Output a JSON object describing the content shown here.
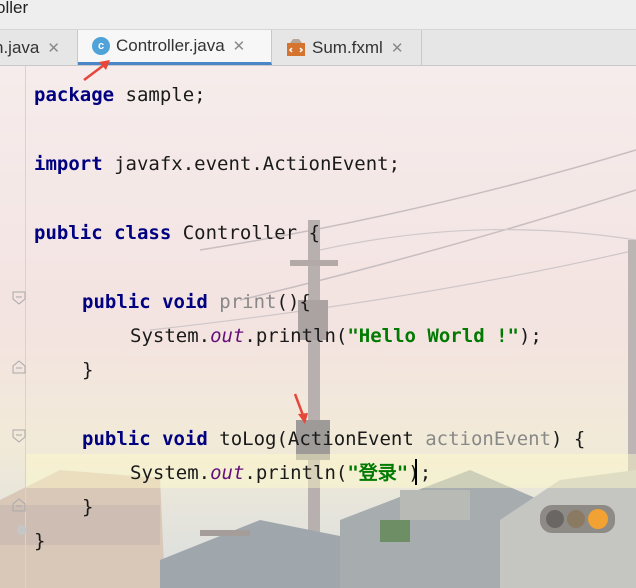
{
  "window": {
    "title": "oller"
  },
  "tabs": [
    {
      "label": "n.java",
      "close": "✕",
      "icon": "none",
      "active": false
    },
    {
      "label": "Controller.java",
      "close": "✕",
      "icon": "java-class-icon",
      "active": true
    },
    {
      "label": "Sum.fxml",
      "close": "✕",
      "icon": "fxml-file-icon",
      "active": false
    }
  ],
  "code": {
    "line1": {
      "kw": "package",
      "rest": " sample;"
    },
    "line3": {
      "kw": "import",
      "rest": " javafx.event.ActionEvent;"
    },
    "line5": {
      "kw1": "public",
      "kw2": "class",
      "rest": " Controller {"
    },
    "line7": {
      "kw1": "public",
      "kw2": "void",
      "name": " print",
      "rest": "(){"
    },
    "line8": {
      "pre": "System.",
      "field": "out",
      "mid": ".println(",
      "str": "\"Hello World !\"",
      "end": ");"
    },
    "line9": {
      "text": "}"
    },
    "line11": {
      "kw1": "public",
      "kw2": "void",
      "name": " toLog(ActionEvent ",
      "param": "actionEvent",
      "rest": ") {"
    },
    "line12": {
      "pre": "System.",
      "field": "out",
      "mid": ".println(",
      "str": "\"登录\"",
      "end": ");"
    },
    "line13": {
      "text": "}"
    },
    "line14": {
      "text": "}"
    }
  },
  "colors": {
    "keyword": "#000080",
    "string": "#007a00",
    "field": "#660e7a",
    "annotation_arrow": "#e8463a"
  }
}
